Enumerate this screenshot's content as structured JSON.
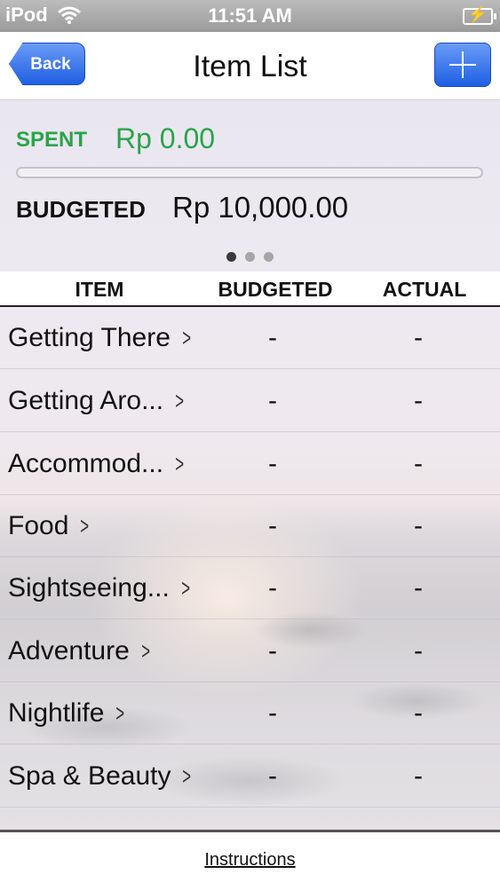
{
  "status_bar": {
    "carrier": "iPod",
    "time": "11:51 AM",
    "wifi_icon": "wifi-icon",
    "battery_icon": "battery-charging-icon"
  },
  "nav": {
    "back_label": "Back",
    "title": "Item List",
    "add_icon": "plus-icon"
  },
  "summary": {
    "spent_label": "SPENT",
    "spent_value": "Rp 0.00",
    "budgeted_label": "BUDGETED",
    "budgeted_value": "Rp 10,000.00",
    "progress_fraction": 0.0,
    "page_count": 3,
    "current_page": 1
  },
  "columns": {
    "item": "ITEM",
    "budgeted": "BUDGETED",
    "actual": "ACTUAL"
  },
  "rows": [
    {
      "name": "Getting There",
      "budgeted": "-",
      "actual": "-"
    },
    {
      "name": "Getting Aro...",
      "budgeted": "-",
      "actual": "-"
    },
    {
      "name": "Accommod...",
      "budgeted": "-",
      "actual": "-"
    },
    {
      "name": "Food",
      "budgeted": "-",
      "actual": "-"
    },
    {
      "name": "Sightseeing...",
      "budgeted": "-",
      "actual": "-"
    },
    {
      "name": "Adventure",
      "budgeted": "-",
      "actual": "-"
    },
    {
      "name": "Nightlife",
      "budgeted": "-",
      "actual": "-"
    },
    {
      "name": "Spa & Beauty",
      "budgeted": "-",
      "actual": "-"
    }
  ],
  "footer": {
    "instructions_label": "Instructions"
  },
  "colors": {
    "spent_green": "#2aa44a",
    "button_blue": "#1f5fe3"
  }
}
